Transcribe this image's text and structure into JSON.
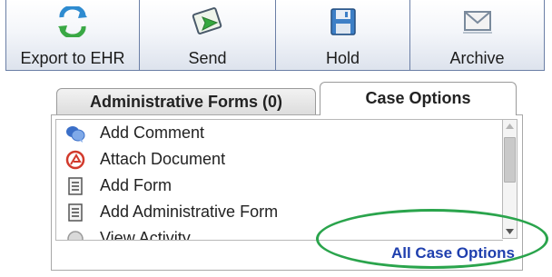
{
  "toolbar": {
    "buttons": [
      {
        "label": "Export to EHR",
        "icon": "export-ehr-icon"
      },
      {
        "label": "Send",
        "icon": "send-icon"
      },
      {
        "label": "Hold",
        "icon": "save-disk-icon"
      },
      {
        "label": "Archive",
        "icon": "archive-envelope-icon"
      }
    ]
  },
  "tabs": [
    {
      "label": "Administrative Forms (0)",
      "selected": false
    },
    {
      "label": "Case Options",
      "selected": true
    }
  ],
  "case_options": {
    "items": [
      {
        "label": "Add Comment",
        "icon": "comment-bubbles-icon"
      },
      {
        "label": "Attach Document",
        "icon": "attach-document-icon"
      },
      {
        "label": "Add Form",
        "icon": "form-icon"
      },
      {
        "label": "Add Administrative Form",
        "icon": "form-icon"
      },
      {
        "label": "View Activity",
        "icon": "activity-icon"
      }
    ],
    "all_link": "All Case Options"
  },
  "colors": {
    "link": "#1f3fae",
    "highlight_ring": "#2aa44c",
    "toolbar_border": "#6b7fa6"
  }
}
